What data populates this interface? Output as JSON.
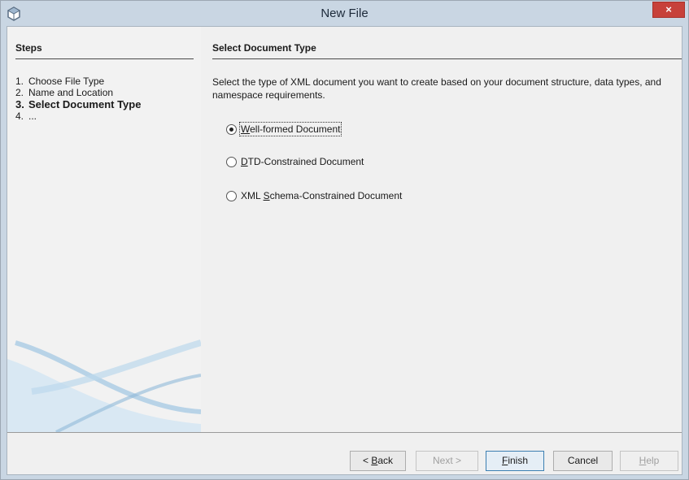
{
  "window": {
    "title": "New File",
    "close_label": "×"
  },
  "steps": {
    "header": "Steps",
    "items": [
      {
        "num": "1.",
        "label": "Choose File Type"
      },
      {
        "num": "2.",
        "label": "Name and Location"
      },
      {
        "num": "3.",
        "label": "Select Document Type"
      },
      {
        "num": "4.",
        "label": "..."
      }
    ]
  },
  "panel": {
    "title": "Select Document Type",
    "description": "Select the type of XML document you want to create based on your document structure, data types, and namespace requirements.",
    "options": [
      {
        "mnemonic": "W",
        "rest": "ell-formed Document",
        "selected": true
      },
      {
        "mnemonic": "D",
        "rest": "TD-Constrained Document",
        "selected": false
      },
      {
        "prefix": "XML ",
        "mnemonic": "S",
        "rest": "chema-Constrained Document",
        "selected": false
      }
    ]
  },
  "buttons": {
    "back": {
      "pre": "< ",
      "mnemonic": "B",
      "rest": "ack"
    },
    "next": "Next >",
    "finish": {
      "mnemonic": "F",
      "rest": "inish"
    },
    "cancel": "Cancel",
    "help": {
      "mnemonic": "H",
      "rest": "elp"
    }
  },
  "colors": {
    "titlebar": "#c9d6e3",
    "close": "#c7413a",
    "swoosh": "#8fb9d8"
  }
}
